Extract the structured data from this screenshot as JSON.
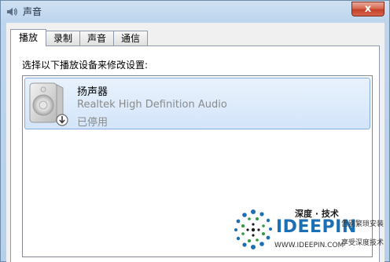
{
  "window": {
    "title": "声音",
    "close_glyph": "x"
  },
  "tabs": [
    {
      "label": "播放",
      "active": true
    },
    {
      "label": "录制",
      "active": false
    },
    {
      "label": "声音",
      "active": false
    },
    {
      "label": "通信",
      "active": false
    }
  ],
  "playback": {
    "instruction": "选择以下播放设备来修改设置:",
    "devices": [
      {
        "name": "扬声器",
        "description": "Realtek High Definition Audio",
        "status": "已停用",
        "icon": "speaker-icon",
        "overlay_icon": "disabled-arrow-icon"
      }
    ]
  },
  "watermark": {
    "chinese_name": "深度 · 技术",
    "brand": "IDEEPIN",
    "url": "WWW.IDEEPIN.COM",
    "tagline_1": "告别繁琐安装",
    "tagline_2": "享受深度技术"
  },
  "colors": {
    "title_bar": "#bdd5ee",
    "selection": "#d3e5fa",
    "selection_border": "#84acdd",
    "close_button": "#c4412a",
    "brand_blue": "#1d6fb5",
    "disabled_text": "#8a8a8a"
  }
}
